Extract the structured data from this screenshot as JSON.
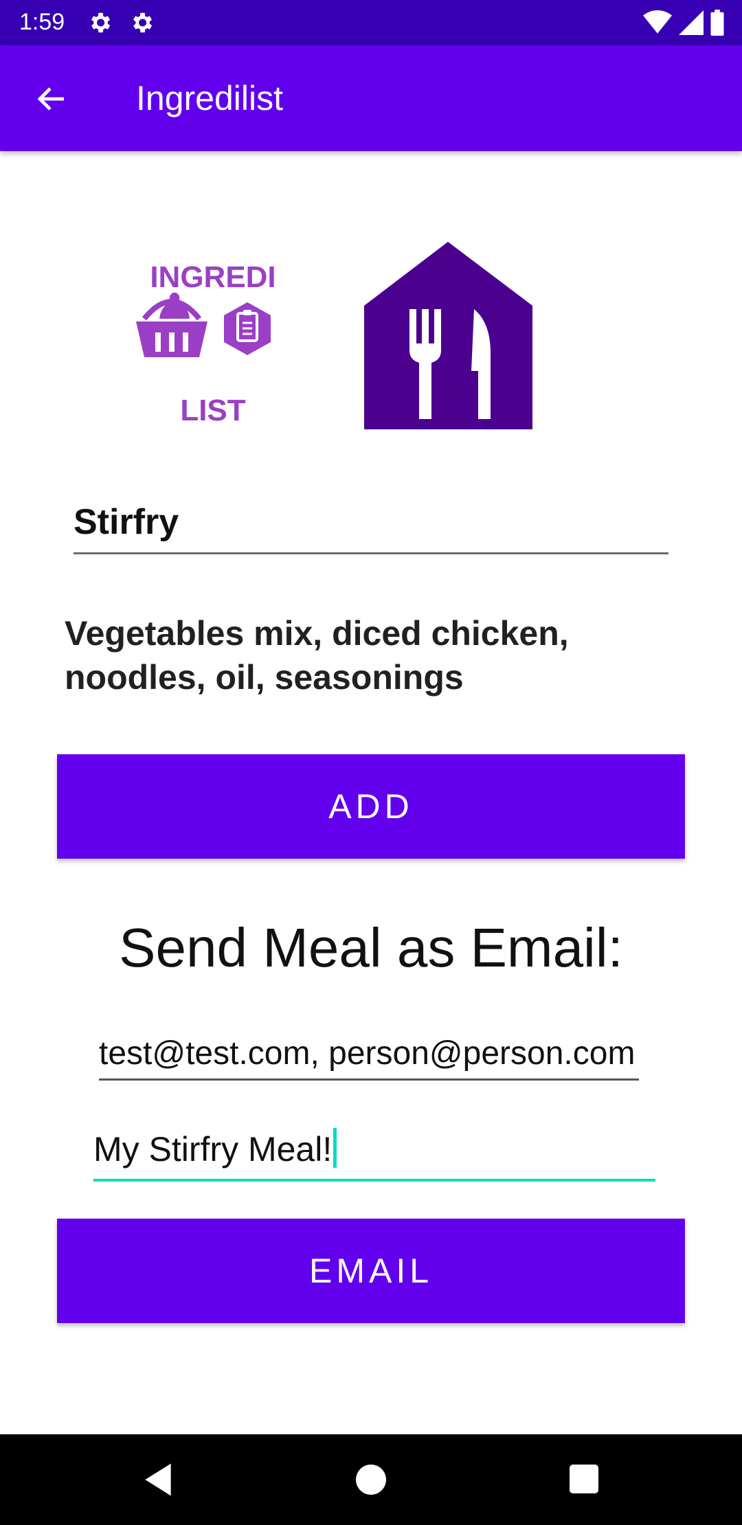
{
  "status_bar": {
    "time": "1:59",
    "icons": [
      "settings-icon",
      "settings-icon",
      "wifi-icon",
      "signal-icon",
      "battery-icon"
    ]
  },
  "app_bar": {
    "title": "Ingredilist",
    "back_icon": "arrow-back-icon"
  },
  "logos": {
    "app_logo_text_top": "INGREDI",
    "app_logo_text_bottom": "LIST",
    "restaurant_icon": "fork-knife-house-icon"
  },
  "meal": {
    "name": "Stirfry",
    "ingredients": "Vegetables mix, diced chicken, noodles, oil, seasonings"
  },
  "buttons": {
    "add": "ADD",
    "email": "EMAIL"
  },
  "email": {
    "heading": "Send Meal as Email:",
    "recipients": "test@test.com, person@person.com",
    "subject": "My Stirfry Meal!"
  },
  "colors": {
    "status_bar": "#3700b3",
    "primary": "#6200ee",
    "accent": "#03dac5",
    "logo_purple": "#9b3fc6",
    "house_purple": "#4b0090"
  }
}
